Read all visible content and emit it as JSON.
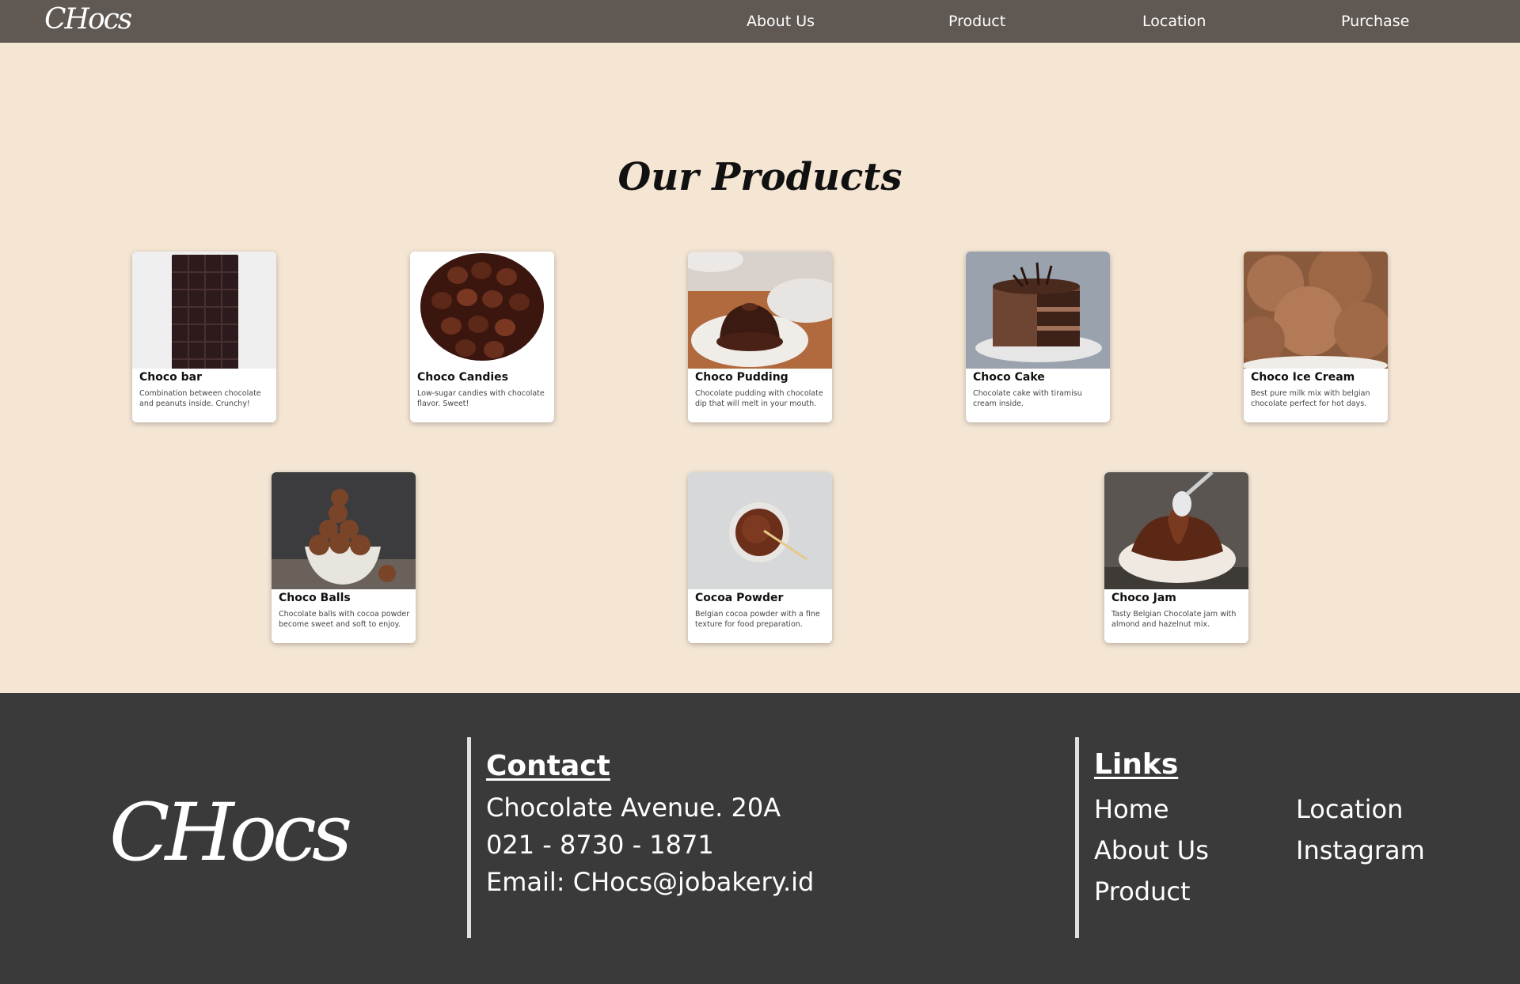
{
  "nav": {
    "logo": "CHocs",
    "links": [
      "About Us",
      "Product",
      "Location",
      "Purchase"
    ]
  },
  "products_heading": "Our Products",
  "products": [
    {
      "name": "Choco bar",
      "desc": "Combination between chocolate and peanuts inside. Crunchy!",
      "image": "chocolate-bar-image"
    },
    {
      "name": "Choco Candies",
      "desc": "Low-sugar candies with chocolate flavor. Sweet!",
      "image": "chocolate-candies-image"
    },
    {
      "name": "Choco Pudding",
      "desc": "Chocolate pudding with chocolate dip that will melt in your mouth.",
      "image": "chocolate-pudding-image"
    },
    {
      "name": "Choco Cake",
      "desc": "Chocolate cake with tiramisu cream inside.",
      "image": "chocolate-cake-image"
    },
    {
      "name": "Choco Ice Cream",
      "desc": "Best pure milk mix with belgian chocolate perfect for hot days.",
      "image": "chocolate-ice-cream-image"
    },
    {
      "name": "Choco Balls",
      "desc": "Chocolate balls with cocoa powder become sweet and soft to enjoy.",
      "image": "chocolate-balls-image"
    },
    {
      "name": "Cocoa Powder",
      "desc": "Belgian cocoa powder with a fine texture for food preparation.",
      "image": "cocoa-powder-image"
    },
    {
      "name": "Choco Jam",
      "desc": "Tasty Belgian Chocolate jam with almond and hazelnut mix.",
      "image": "chocolate-jam-image"
    }
  ],
  "footer": {
    "logo": "CHocs",
    "contact": {
      "title": "Contact",
      "address": "Chocolate Avenue. 20A",
      "phone": "021 - 8730 - 1871",
      "email": "Email: CHocs@jobakery.id"
    },
    "links": {
      "title": "Links",
      "items": [
        "Home",
        "About Us",
        "Product",
        "Location",
        "Instagram"
      ]
    }
  },
  "colors": {
    "nav_bg": "#5f5853",
    "page_bg": "#f5e6d4",
    "footer_bg": "#3a3a3a"
  }
}
